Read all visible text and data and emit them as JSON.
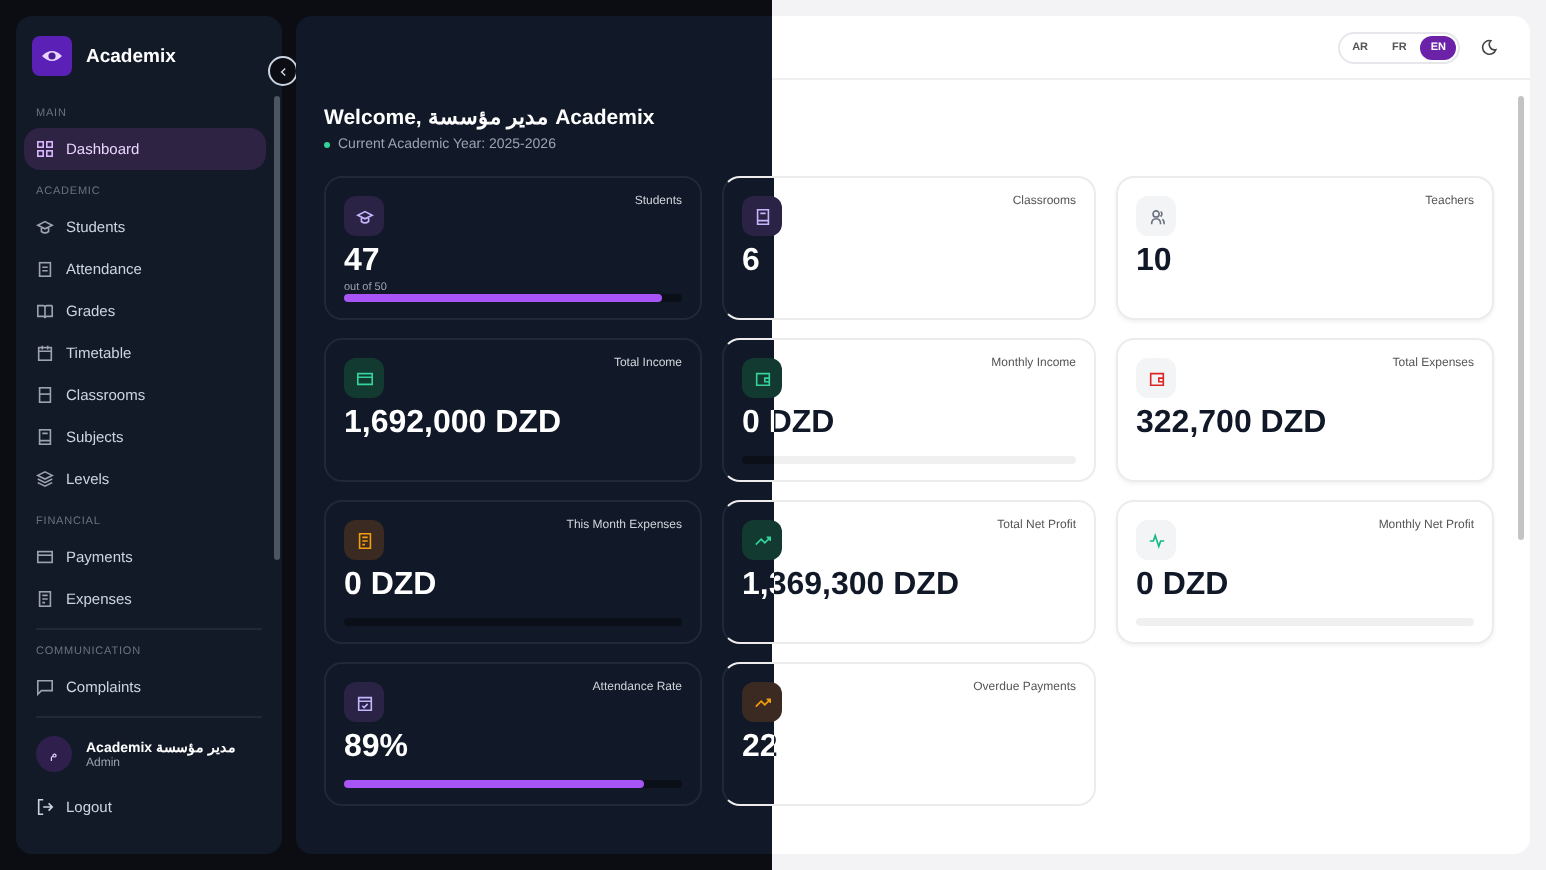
{
  "sidebar": {
    "brand": "Academix",
    "sections": [
      {
        "heading": "MAIN",
        "items": [
          {
            "label": "Dashboard",
            "selected": true
          }
        ]
      },
      {
        "heading": "ACADEMIC",
        "items": [
          {
            "label": "Students",
            "selected": false
          },
          {
            "label": "Attendance",
            "selected": false
          },
          {
            "label": "Grades",
            "selected": false
          },
          {
            "label": "Timetable",
            "selected": false
          },
          {
            "label": "Classrooms",
            "selected": false
          },
          {
            "label": "Subjects",
            "selected": false
          },
          {
            "label": "Levels",
            "selected": false
          }
        ]
      },
      {
        "heading": "FINANCIAL",
        "items": [
          {
            "label": "Payments",
            "selected": false
          },
          {
            "label": "Expenses",
            "selected": false
          }
        ]
      },
      {
        "heading": "COMMUNICATION",
        "items": [
          {
            "label": "Complaints",
            "selected": false
          }
        ]
      }
    ],
    "user": {
      "initial": "م",
      "name": "مدير مؤسسة Academix",
      "role": "Admin"
    },
    "logout": "Logout"
  },
  "header": {
    "languages": [
      {
        "label": "AR",
        "selected": false
      },
      {
        "label": "FR",
        "selected": false
      },
      {
        "label": "EN",
        "selected": true
      }
    ]
  },
  "welcome": {
    "title": "Welcome, مدير مؤسسة Academix",
    "subtitle": "Current Academic Year: 2025-2026"
  },
  "cards": [
    {
      "kind": "bar",
      "title": "Students",
      "value": "47",
      "sub": "out of 50",
      "level": 0.94
    },
    {
      "kind": "plain",
      "title": "Classrooms",
      "value": "6"
    },
    {
      "kind": "plain",
      "title": "Teachers",
      "value": "10"
    },
    {
      "kind": "plain",
      "title": "Total Income",
      "value": "1,692,000 DZD"
    },
    {
      "kind": "bar",
      "title": "Monthly Income",
      "value": "0 DZD"
    },
    {
      "kind": "plain",
      "title": "Total Expenses",
      "value": "322,700 DZD"
    },
    {
      "kind": "bar",
      "title": "This Month Expenses",
      "value": "0 DZD"
    },
    {
      "kind": "plain",
      "title": "Total Net Profit",
      "value": "1,369,300 DZD"
    },
    {
      "kind": "bar",
      "title": "Monthly Net Profit",
      "value": "0 DZD"
    },
    {
      "kind": "bar",
      "title": "Attendance Rate",
      "value": "89%",
      "level": 0.89
    },
    {
      "kind": "plain",
      "title": "Overdue Payments",
      "value": "22"
    }
  ]
}
